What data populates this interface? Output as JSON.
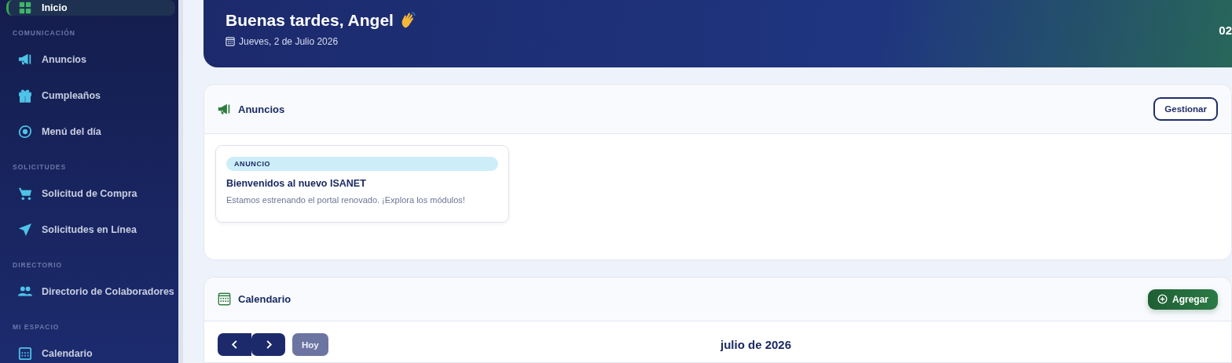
{
  "sidebar": {
    "sections": [
      {
        "items": [
          {
            "label": "Inicio",
            "kind": "grid",
            "selected": true
          }
        ]
      },
      {
        "title": "COMUNICACIÓN",
        "items": [
          {
            "label": "Anuncios",
            "kind": "megaphone",
            "selected": false
          },
          {
            "label": "Cumpleaños",
            "kind": "gift",
            "selected": false
          },
          {
            "label": "Menú del día",
            "kind": "egg",
            "selected": false
          }
        ]
      },
      {
        "title": "SOLICITUDES",
        "items": [
          {
            "label": "Solicitud de Compra",
            "kind": "cart",
            "selected": false
          },
          {
            "label": "Solicitudes en Línea",
            "kind": "plane",
            "selected": false
          }
        ]
      },
      {
        "title": "DIRECTORIO",
        "items": [
          {
            "label": "Directorio de Colaboradores",
            "kind": "users",
            "selected": false
          }
        ]
      },
      {
        "title": "MI ESPACIO",
        "items": [
          {
            "label": "Calendario",
            "kind": "calendar",
            "selected": false
          }
        ]
      }
    ]
  },
  "header": {
    "greeting": "Buenas tardes, Angel",
    "date": "Jueves, 2 de Julio 2026",
    "right_text": "02"
  },
  "announcements": {
    "title": "Anuncios",
    "button": "Gestionar",
    "items": [
      {
        "tag": "ANUNCIO",
        "title": "Bienvenidos al nuevo ISANET",
        "text": "Estamos estrenando el portal renovado. ¡Explora los módulos!"
      }
    ]
  },
  "calendar": {
    "title": "Calendario",
    "button": "Agregar",
    "today_button": {
      "label": "Hoy",
      "disabled": true
    },
    "month": "julio de 2026"
  }
}
